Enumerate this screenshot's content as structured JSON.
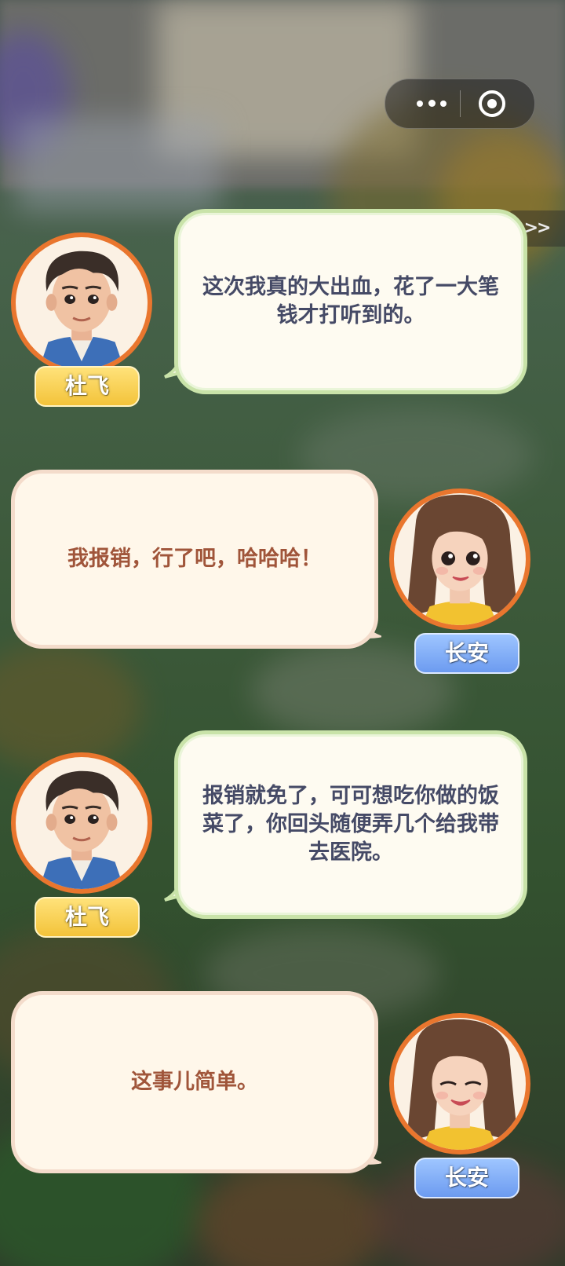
{
  "menu_capsule": {
    "more_icon": "more-dots-icon",
    "close_icon": "target-close-icon"
  },
  "skip_button": {
    "label": ">>"
  },
  "dialogue": [
    {
      "speaker": "杜飞",
      "side": "left",
      "text_lines": [
        "这次我真的大出血，花了一大笔",
        "钱才打听到的。"
      ]
    },
    {
      "speaker": "长安",
      "side": "right",
      "text_lines": [
        "我报销，行了吧，哈哈哈！"
      ]
    },
    {
      "speaker": "杜飞",
      "side": "left",
      "text_lines": [
        "报销就免了，可可想吃你做的饭",
        "菜了，你回头随便弄几个给我带",
        "去医院。"
      ]
    },
    {
      "speaker": "长安",
      "side": "right",
      "text_lines": [
        "这事儿简单。"
      ]
    }
  ],
  "colors": {
    "left_bubble_border": "#c9e3a9",
    "right_bubble_border": "#f4dccb",
    "left_text": "#454a66",
    "right_text": "#a0553a",
    "avatar_ring": "#e9762e",
    "tag_yellow": "#f3c33a",
    "tag_blue": "#6c9bf0"
  }
}
